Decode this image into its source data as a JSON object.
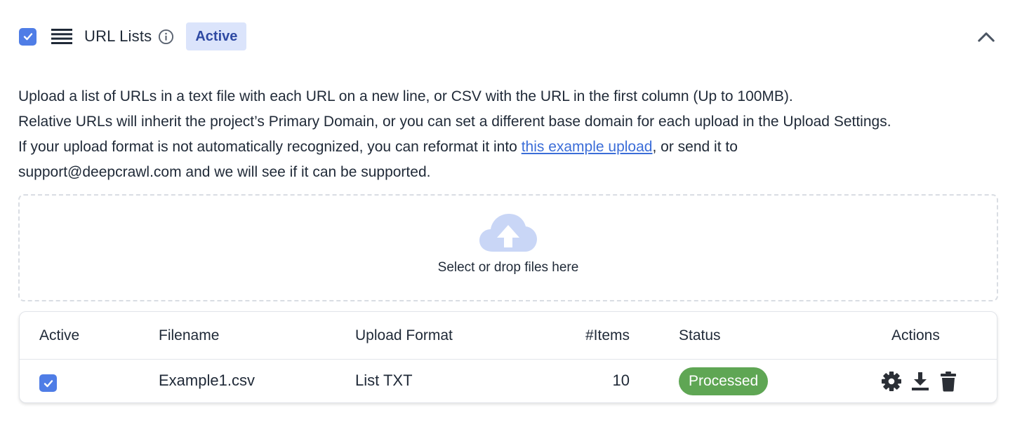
{
  "section": {
    "title": "URL Lists",
    "badge": "Active",
    "enabled": true
  },
  "description": {
    "line1": "Upload a list of URLs in a text file with each URL on a new line, or CSV with the URL in the first column (Up to 100MB).",
    "line2": "Relative URLs will inherit the project’s Primary Domain, or you can set a different base domain for each upload in the Upload Settings.",
    "line3_before": "If your upload format is not automatically recognized, you can reformat it into ",
    "line3_link": "this example upload",
    "line3_after": ", or send it to",
    "line4": "support@deepcrawl.com and we will see if it can be supported."
  },
  "dropzone": {
    "text": "Select or drop files here",
    "icon": "cloud-upload-icon"
  },
  "table": {
    "headers": {
      "active": "Active",
      "filename": "Filename",
      "format": "Upload Format",
      "items": "#Items",
      "status": "Status",
      "actions": "Actions"
    },
    "rows": [
      {
        "active": true,
        "filename": "Example1.csv",
        "format": "List TXT",
        "items": "10",
        "status": "Processed",
        "actions": [
          "gear-icon",
          "download-icon",
          "trash-icon"
        ]
      }
    ]
  },
  "colors": {
    "accent": "#4f7de6",
    "badge_bg": "#dbe4fb",
    "badge_text": "#2f4aa3",
    "status_success": "#5fa654",
    "link": "#3b6dd8"
  }
}
